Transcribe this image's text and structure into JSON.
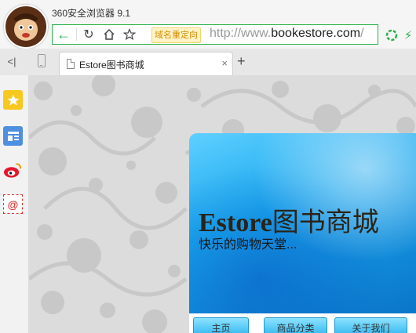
{
  "browser": {
    "app_title": "360安全浏览器 9.1",
    "address_bar": {
      "redirect_badge": "域名重定向",
      "url_prefix": "http://www.",
      "url_domain": "bookestore.com",
      "url_suffix": "/"
    },
    "tab": {
      "title": "Estore图书商城",
      "close": "×"
    },
    "new_tab": "+",
    "sidebar_toggle": "<|",
    "sidebar_mail_glyph": "@"
  },
  "page": {
    "banner": {
      "title_latin": "Estore",
      "title_cn": "图书商城",
      "subtitle": "快乐的购物天堂..."
    },
    "menu": [
      {
        "label": "主页"
      },
      {
        "label": "商品分类"
      },
      {
        "label": "关于我们"
      }
    ]
  },
  "colors": {
    "accent": "#2bb24c",
    "banner_blue": "#1aa7ee",
    "redirect_badge_bg": "#fff4c7"
  },
  "icons": [
    "avatar",
    "back-arrow-icon",
    "reload-icon",
    "home-icon",
    "star-icon",
    "extension-icon",
    "bolt-icon",
    "phone-icon",
    "page-icon",
    "close-icon",
    "plus-icon",
    "favorites-star-icon",
    "news-icon",
    "weibo-icon",
    "mail-icon"
  ]
}
